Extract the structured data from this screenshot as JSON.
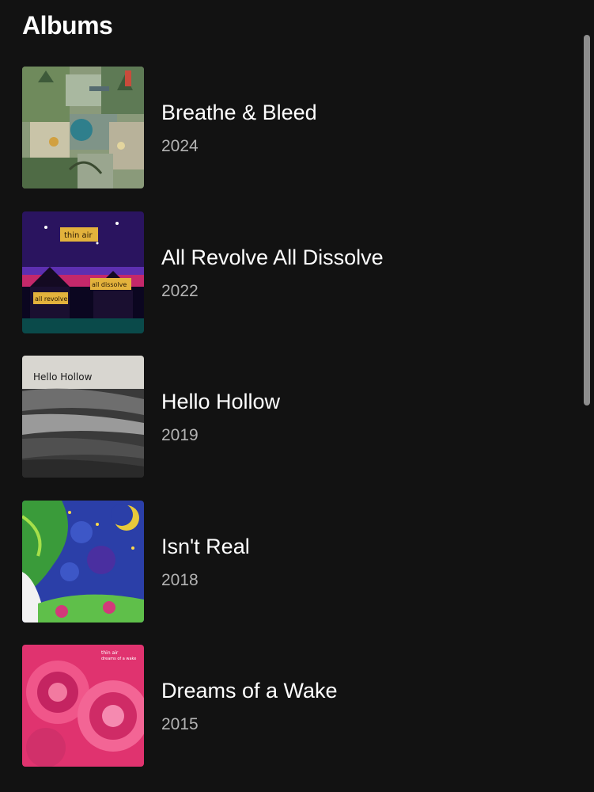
{
  "section": {
    "title": "Albums"
  },
  "albums": [
    {
      "title": "Breathe & Bleed",
      "year": "2024",
      "cover_icon": "collage-art-cover"
    },
    {
      "title": "All Revolve All Dissolve",
      "year": "2022",
      "cover_icon": "neon-houses-cover",
      "cover_text": [
        "thin air",
        "all revolve",
        "all dissolve"
      ]
    },
    {
      "title": "Hello Hollow",
      "year": "2019",
      "cover_icon": "gray-brushstroke-cover",
      "cover_text": [
        "Hello Hollow"
      ]
    },
    {
      "title": "Isn't Real",
      "year": "2018",
      "cover_icon": "starry-night-moon-cover"
    },
    {
      "title": "Dreams of a Wake",
      "year": "2015",
      "cover_icon": "pink-roses-cover",
      "cover_text": [
        "thin air",
        "dreams of a wake"
      ]
    }
  ],
  "colors": {
    "background": "#121212",
    "title_text": "#ffffff",
    "year_text": "#b3b3b3",
    "scrollbar": "#8e8e8e"
  }
}
